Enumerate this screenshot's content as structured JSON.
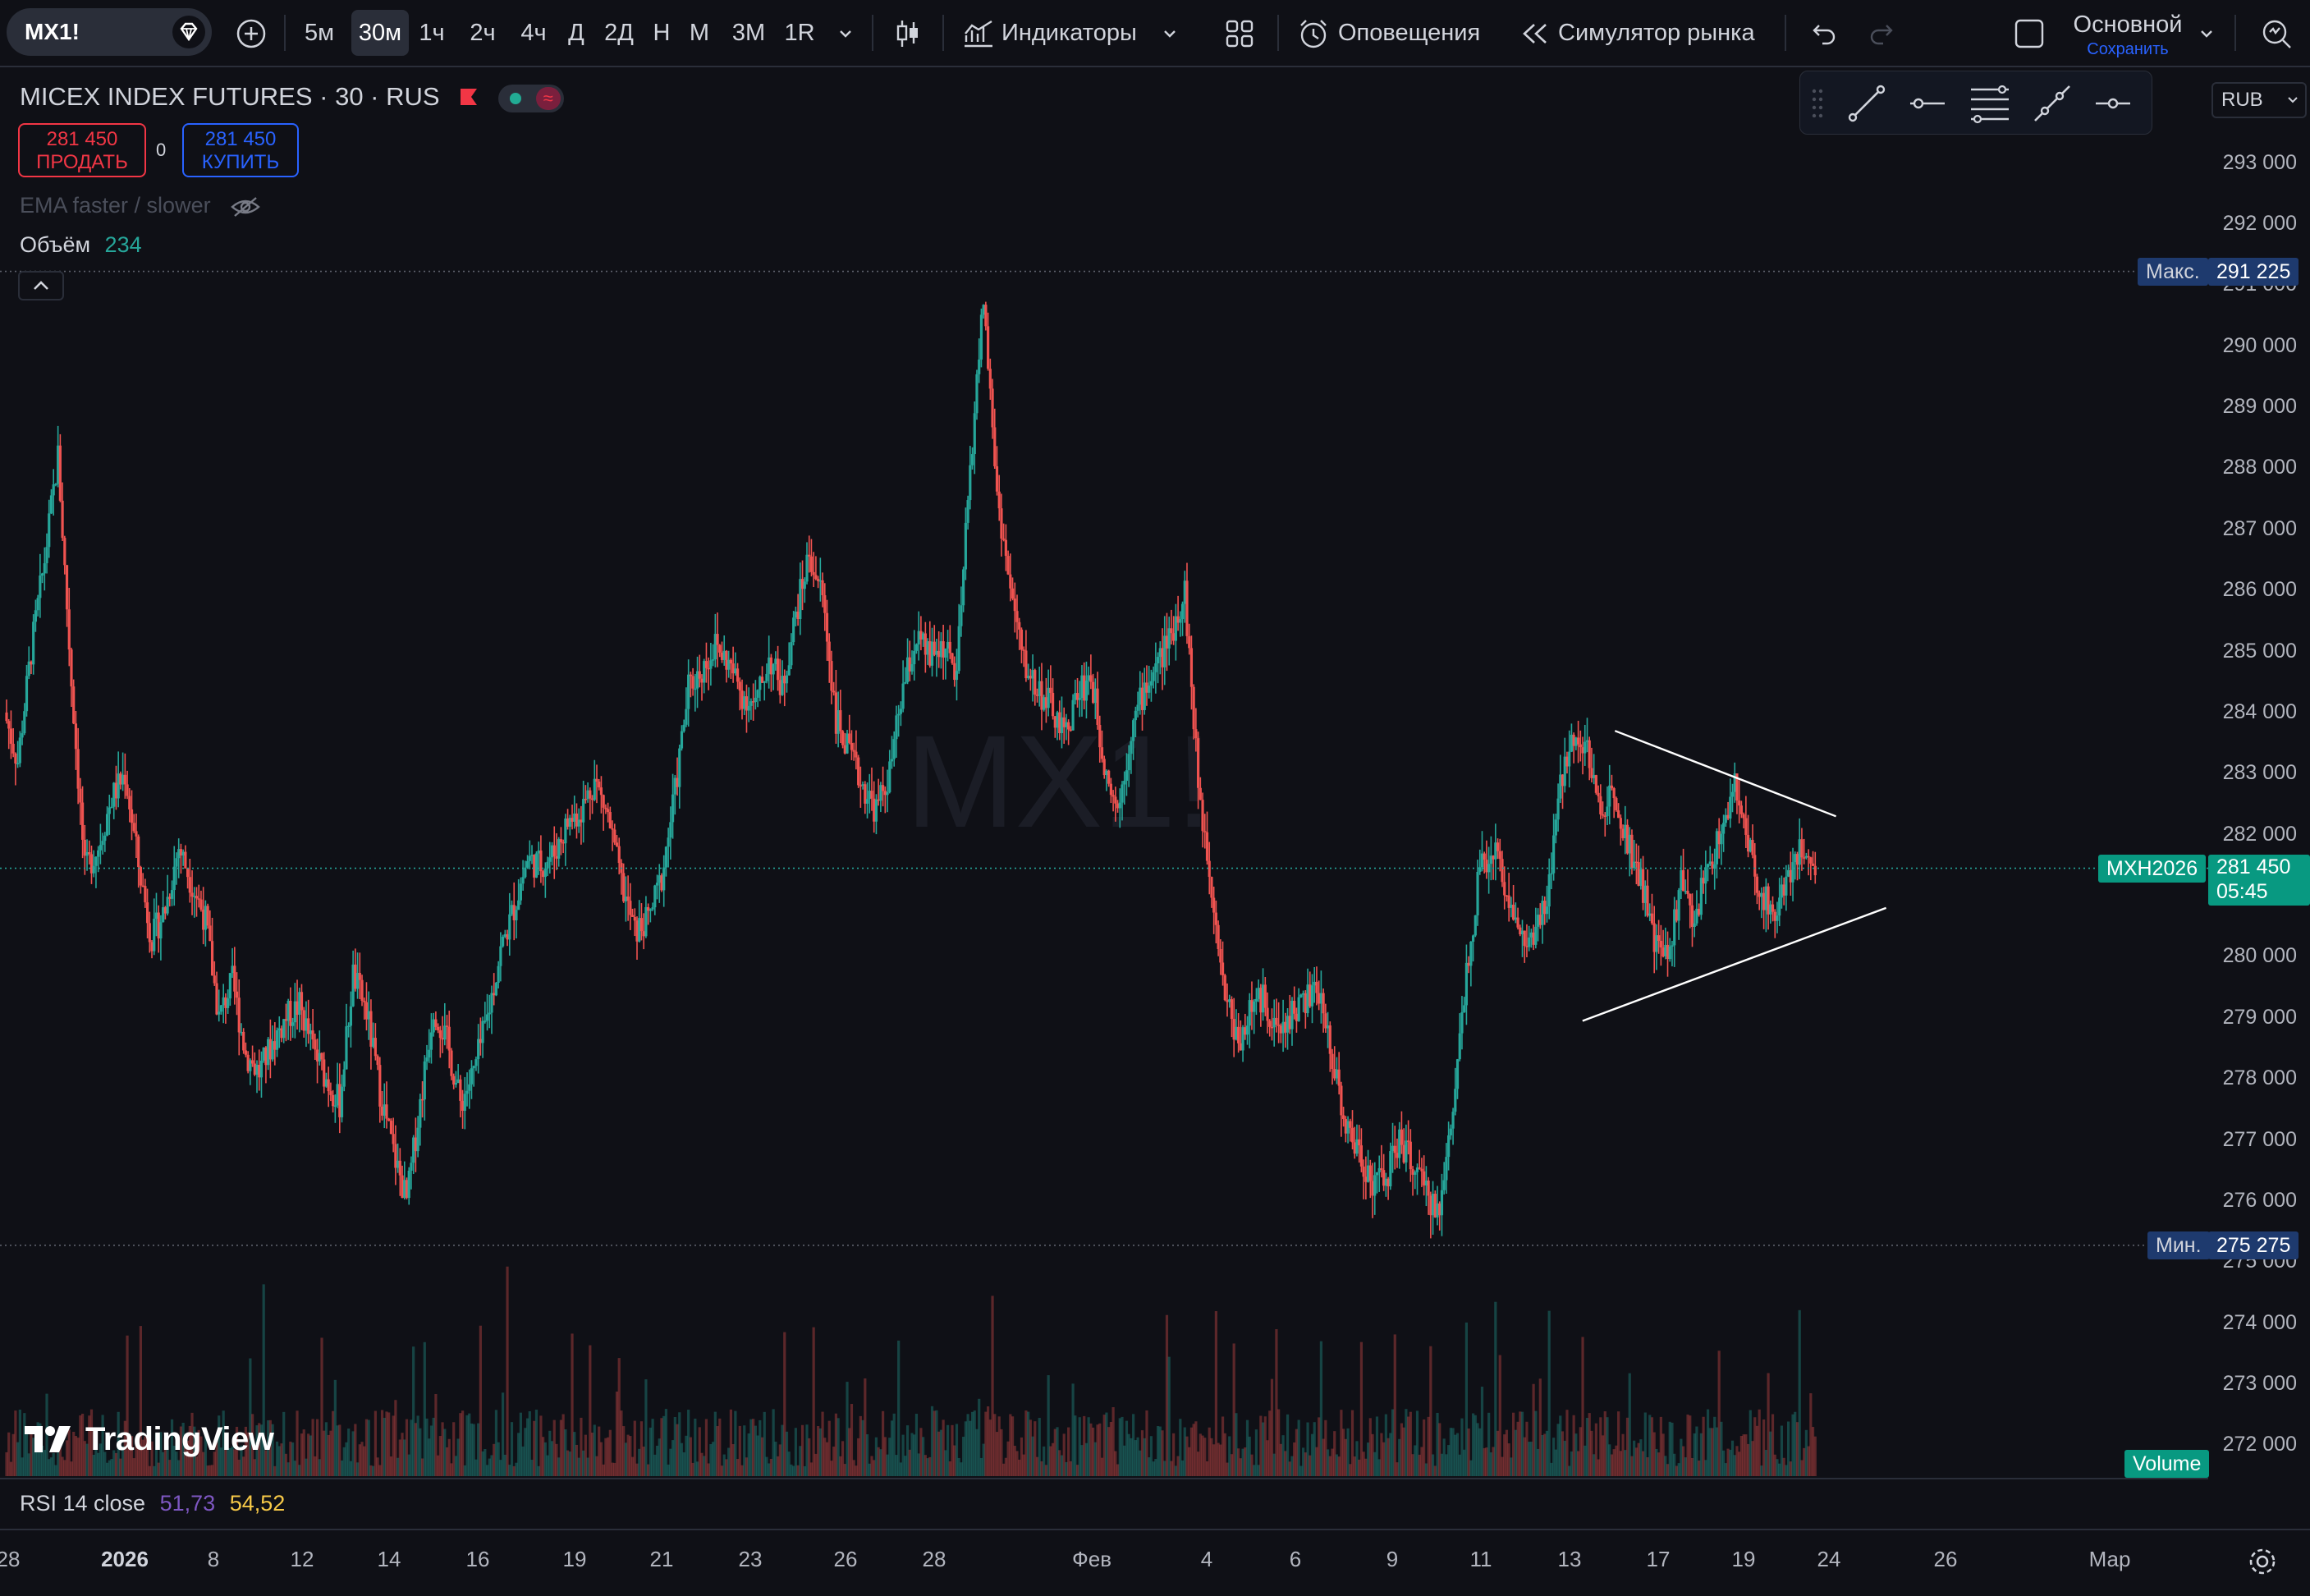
{
  "toolbar": {
    "symbol": "MX1!",
    "intervals": [
      "5м",
      "30м",
      "1ч",
      "2ч",
      "4ч",
      "Д",
      "2Д",
      "Н",
      "М",
      "3М",
      "1R"
    ],
    "active_interval": "30м",
    "indicators_label": "Индикаторы",
    "alerts_label": "Оповещения",
    "replay_label": "Симулятор рынка",
    "layout_name": "Основной",
    "save_label": "Сохранить"
  },
  "legend": {
    "title": "MICEX INDEX FUTURES · 30 · RUS",
    "sell_price": "281 450",
    "sell_label": "ПРОДАТЬ",
    "spread": "0",
    "buy_price": "281 450",
    "buy_label": "КУПИТЬ",
    "ema_label": "EMA faster / slower",
    "volume_label": "Объём",
    "volume_value": "234"
  },
  "watermark": "MX1!",
  "currency": "RUB",
  "price_axis": {
    "ticks": [
      "293 000",
      "292 000",
      "291 000",
      "290 000",
      "289 000",
      "288 000",
      "287 000",
      "286 000",
      "285 000",
      "284 000",
      "283 000",
      "282 000",
      "281 000",
      "280 000",
      "279 000",
      "278 000",
      "277 000",
      "276 000",
      "275 000",
      "274 000",
      "273 000",
      "272 000"
    ],
    "max_label": "Макс.",
    "max_value": "291 225",
    "min_label": "Мин.",
    "min_value": "275 275",
    "current_symbol": "MXH2026",
    "current_price": "281 450",
    "countdown": "05:45",
    "volume_tag": "Volume"
  },
  "rsi": {
    "label": "RSI 14 close",
    "value1": "51,73",
    "value2": "54,52"
  },
  "time_axis": {
    "labels": [
      "28",
      "2026",
      "8",
      "12",
      "14",
      "16",
      "19",
      "21",
      "23",
      "26",
      "28",
      "Фев",
      "4",
      "6",
      "9",
      "11",
      "13",
      "17",
      "19",
      "24",
      "26",
      "Мар"
    ]
  },
  "branding": "TradingView",
  "colors": {
    "up": "#26a69a",
    "down": "#ef5350",
    "background": "#0f1016",
    "accent_blue": "#2962ff",
    "tag_navy": "#1e3a6e",
    "text_dim": "#787b86"
  },
  "chart_data": {
    "type": "candlestick",
    "ylim": [
      271500,
      293500
    ],
    "max": 291225,
    "min": 275275,
    "current": 281450,
    "x_labels": [
      "28",
      "2026",
      "8",
      "12",
      "14",
      "16",
      "19",
      "21",
      "23",
      "26",
      "28",
      "Фев",
      "4",
      "6",
      "9",
      "11",
      "13",
      "17",
      "19",
      "24",
      "26",
      "Мар"
    ],
    "close_series": [
      284000,
      283200,
      285000,
      286500,
      288200,
      284500,
      281400,
      281800,
      282600,
      283000,
      281500,
      280300,
      280800,
      281800,
      281200,
      280600,
      279000,
      279600,
      278400,
      278100,
      278600,
      279000,
      279200,
      278500,
      278000,
      277600,
      279700,
      279100,
      277800,
      276800,
      276000,
      277600,
      279200,
      278600,
      277600,
      278100,
      279000,
      280100,
      280800,
      281600,
      281500,
      281700,
      282200,
      282400,
      282900,
      282300,
      281200,
      280400,
      280600,
      281300,
      282700,
      284400,
      284700,
      285100,
      284800,
      284300,
      284100,
      284900,
      284400,
      285600,
      286600,
      285900,
      283900,
      283300,
      282800,
      282400,
      283000,
      284400,
      285200,
      284900,
      285100,
      284600,
      288000,
      290800,
      287600,
      286000,
      284800,
      284400,
      284100,
      283600,
      284300,
      284600,
      283200,
      282400,
      283700,
      284400,
      284800,
      285300,
      286000,
      282800,
      281200,
      279400,
      278600,
      279200,
      279300,
      278700,
      279100,
      279300,
      279400,
      278400,
      277200,
      276800,
      276300,
      276400,
      277000,
      276600,
      276100,
      275800,
      277600,
      279800,
      281400,
      281800,
      281100,
      280300,
      280200,
      280900,
      282800,
      283700,
      283400,
      282300,
      282800,
      281900,
      281300,
      280200,
      280000,
      281200,
      280600,
      281500,
      282000,
      282800,
      281800,
      281000,
      280700,
      281400,
      281800,
      281450
    ],
    "volume_note": "volume histogram bars at the bottom pane",
    "triangle": {
      "upper": [
        [
          1096,
          283700
        ],
        [
          1246,
          282300
        ]
      ],
      "lower": [
        [
          1074,
          278950
        ],
        [
          1280,
          280800
        ]
      ]
    }
  }
}
